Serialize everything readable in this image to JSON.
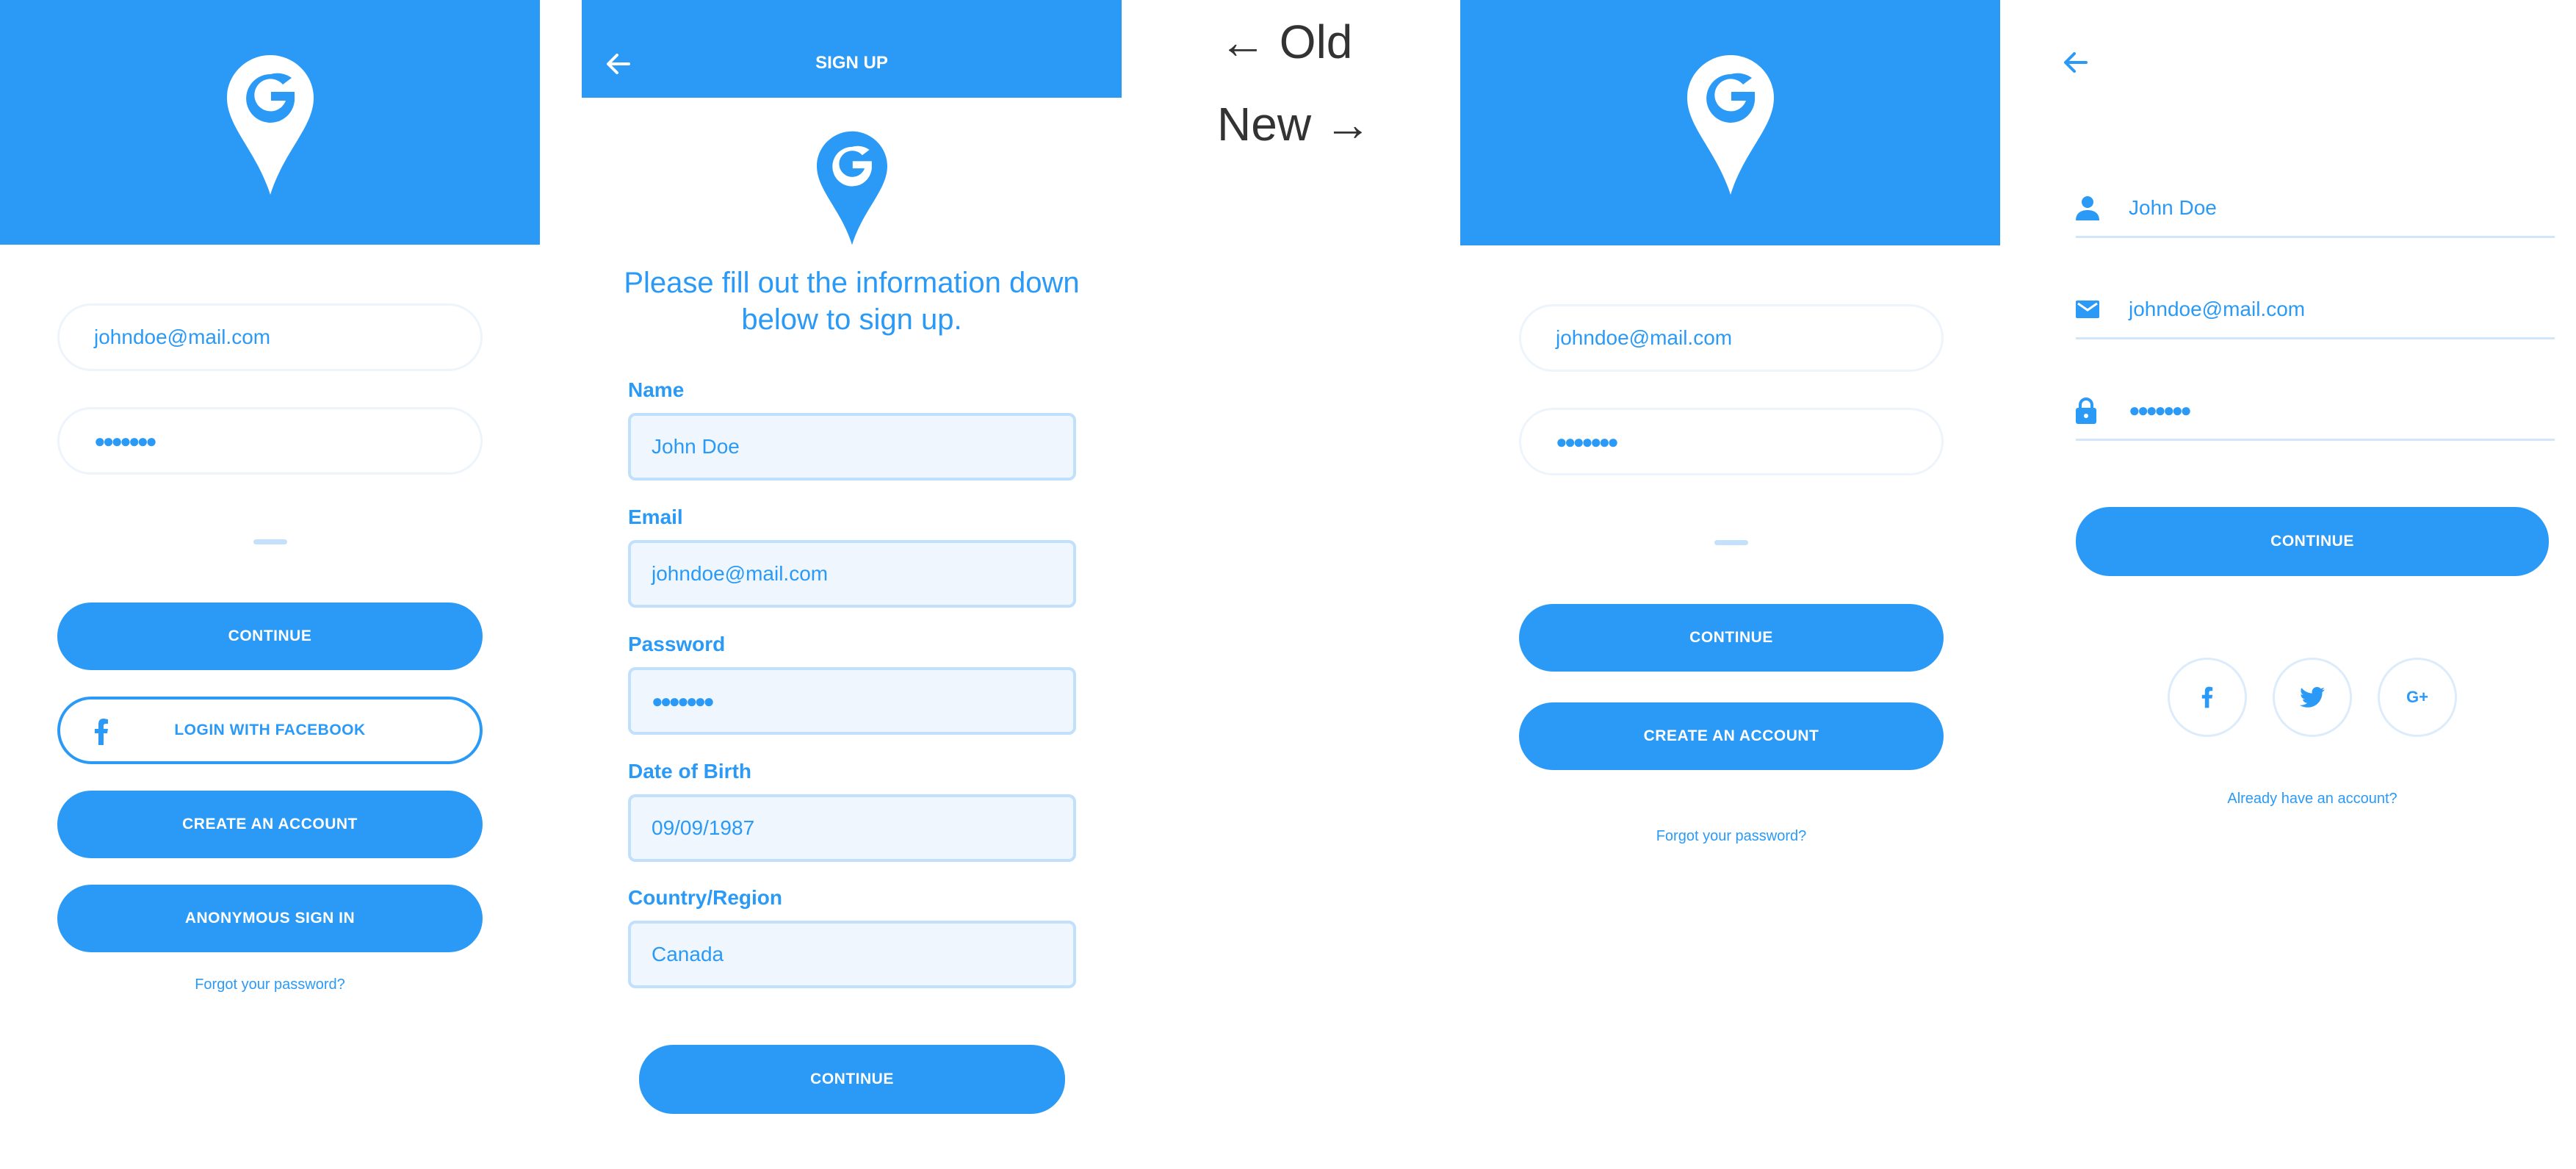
{
  "colors": {
    "brand": "#2a9af6",
    "input_border": "#edf4fb",
    "input_fill": "#eff6fd"
  },
  "old_login": {
    "email_value": "johndoe@mail.com",
    "password_value": "●●●●●●●",
    "continue_label": "CONTINUE",
    "facebook_label": "LOGIN WITH FACEBOOK",
    "create_account_label": "CREATE AN ACCOUNT",
    "anonymous_label": "ANONYMOUS SIGN IN",
    "forgot_label": "Forgot your password?"
  },
  "old_signup": {
    "header_title": "SIGN UP",
    "intro_text": "Please fill out the information down below to sign up.",
    "fields": {
      "name": {
        "label": "Name",
        "value": "John Doe"
      },
      "email": {
        "label": "Email",
        "value": "johndoe@mail.com"
      },
      "password": {
        "label": "Password",
        "value": "●●●●●●●"
      },
      "dob": {
        "label": "Date of Birth",
        "value": "09/09/1987"
      },
      "country": {
        "label": "Country/Region",
        "value": "Canada"
      }
    },
    "continue_label": "CONTINUE"
  },
  "comparison": {
    "old_text": "← Old",
    "new_text": "New →"
  },
  "new_login": {
    "email_value": "johndoe@mail.com",
    "password_value": "●●●●●●●",
    "continue_label": "CONTINUE",
    "create_account_label": "CREATE AN ACCOUNT",
    "forgot_label": "Forgot your password?"
  },
  "new_signup": {
    "name_value": "John Doe",
    "email_value": "johndoe@mail.com",
    "password_value": "●●●●●●●",
    "continue_label": "CONTINUE",
    "social_icons": [
      "facebook-icon",
      "twitter-icon",
      "google-plus-icon"
    ],
    "social_labels": {
      "google": "G+"
    },
    "already_label": "Already have an account?"
  }
}
